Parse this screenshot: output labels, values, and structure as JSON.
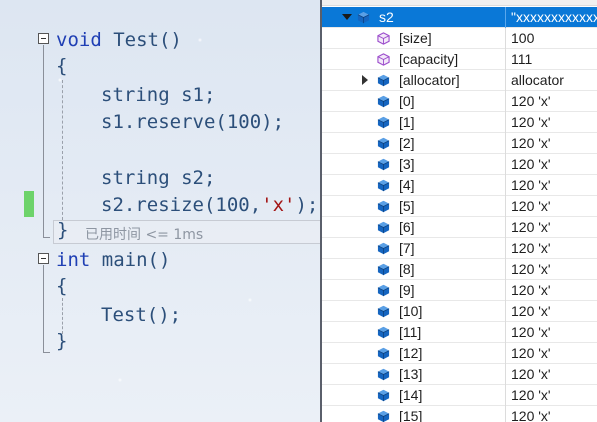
{
  "editor": {
    "lines": {
      "l1_kw": "void",
      "l1_rest": " Test()",
      "l2": "{",
      "l3": "string s1;",
      "l4": "s1.reserve(100);",
      "l5": "string s2;",
      "l6_pre": "s2.resize(100,",
      "l6_str": "'x'",
      "l6_post": ");",
      "l7": "}",
      "l8_kw": "int",
      "l8_rest": " main()",
      "l9": "{",
      "l10": "Test();",
      "l11": "}"
    },
    "timing": "已用时间 <= 1ms"
  },
  "watch": {
    "rows": [
      {
        "name": "s2",
        "value": "\"xxxxxxxxxxxxxxxx",
        "icon": "object-cube-icon"
      },
      {
        "name": "[size]",
        "value": "100",
        "icon": "property-icon"
      },
      {
        "name": "[capacity]",
        "value": "111",
        "icon": "property-icon"
      },
      {
        "name": "[allocator]",
        "value": "allocator",
        "icon": "object-cube-icon"
      },
      {
        "name": "[0]",
        "value": "120 'x'"
      },
      {
        "name": "[1]",
        "value": "120 'x'"
      },
      {
        "name": "[2]",
        "value": "120 'x'"
      },
      {
        "name": "[3]",
        "value": "120 'x'"
      },
      {
        "name": "[4]",
        "value": "120 'x'"
      },
      {
        "name": "[5]",
        "value": "120 'x'"
      },
      {
        "name": "[6]",
        "value": "120 'x'"
      },
      {
        "name": "[7]",
        "value": "120 'x'"
      },
      {
        "name": "[8]",
        "value": "120 'x'"
      },
      {
        "name": "[9]",
        "value": "120 'x'"
      },
      {
        "name": "[10]",
        "value": "120 'x'"
      },
      {
        "name": "[11]",
        "value": "120 'x'"
      },
      {
        "name": "[12]",
        "value": "120 'x'"
      },
      {
        "name": "[13]",
        "value": "120 'x'"
      },
      {
        "name": "[14]",
        "value": "120 'x'"
      },
      {
        "name": "[15]",
        "value": "120 'x'"
      }
    ],
    "colors": {
      "selected": "#0a78d7",
      "cube": "#1565c0",
      "property": "#9c4dcc"
    }
  }
}
